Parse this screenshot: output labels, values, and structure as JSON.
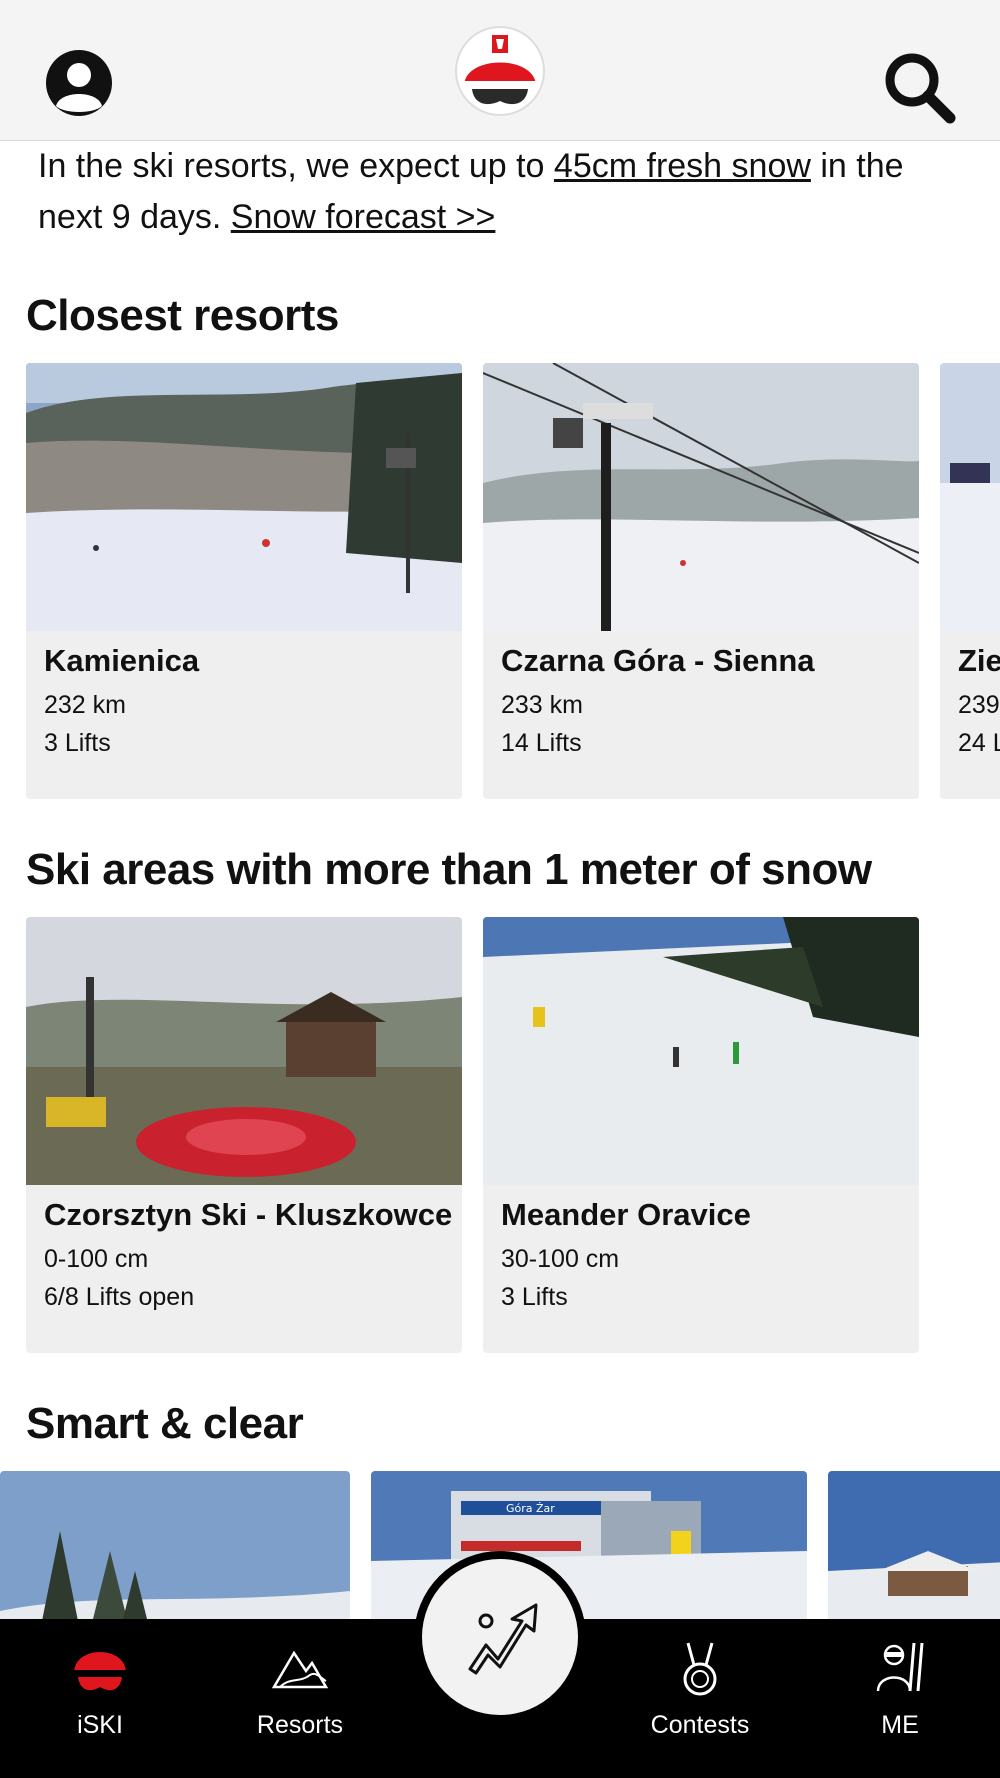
{
  "header": {
    "profile_icon": "user-icon",
    "logo_icon": "iski-poland-helmet-logo",
    "search_icon": "search-icon"
  },
  "intro": {
    "part1": "In the ski resorts, we expect up to ",
    "link_snow": "45cm fresh snow",
    "part2": " in the next 9 days. ",
    "link_forecast": "Snow forecast >>"
  },
  "sections": {
    "closest": {
      "title": "Closest resorts",
      "cards": [
        {
          "name": "Kamienica",
          "line1": "232 km",
          "line2": "3 Lifts"
        },
        {
          "name": "Czarna Góra - Sienna",
          "line1": "233 km",
          "line2": "14 Lifts"
        },
        {
          "name": "Zie",
          "line1": "239",
          "line2": "24 L"
        }
      ]
    },
    "snow": {
      "title": "Ski areas with more than 1 meter of snow",
      "cards": [
        {
          "name": "Czorsztyn Ski - Kluszkowce",
          "line1": "0-100 cm",
          "line2": "6/8 Lifts open"
        },
        {
          "name": "Meander Oravice",
          "line1": "30-100 cm",
          "line2": "3 Lifts"
        }
      ]
    },
    "smart": {
      "title": "Smart & clear",
      "sign_text": "Góra Żar"
    }
  },
  "tabbar": {
    "tabs": [
      {
        "label": "iSKI",
        "icon": "helmet-icon"
      },
      {
        "label": "Resorts",
        "icon": "mountains-icon"
      },
      {
        "label": "Contests",
        "icon": "medal-icon"
      },
      {
        "label": "ME",
        "icon": "skier-icon"
      }
    ],
    "center_icon": "activity-track-icon"
  },
  "colors": {
    "accent_red": "#e0161e",
    "tabbar_bg": "#000000",
    "card_bg": "#efefef"
  }
}
